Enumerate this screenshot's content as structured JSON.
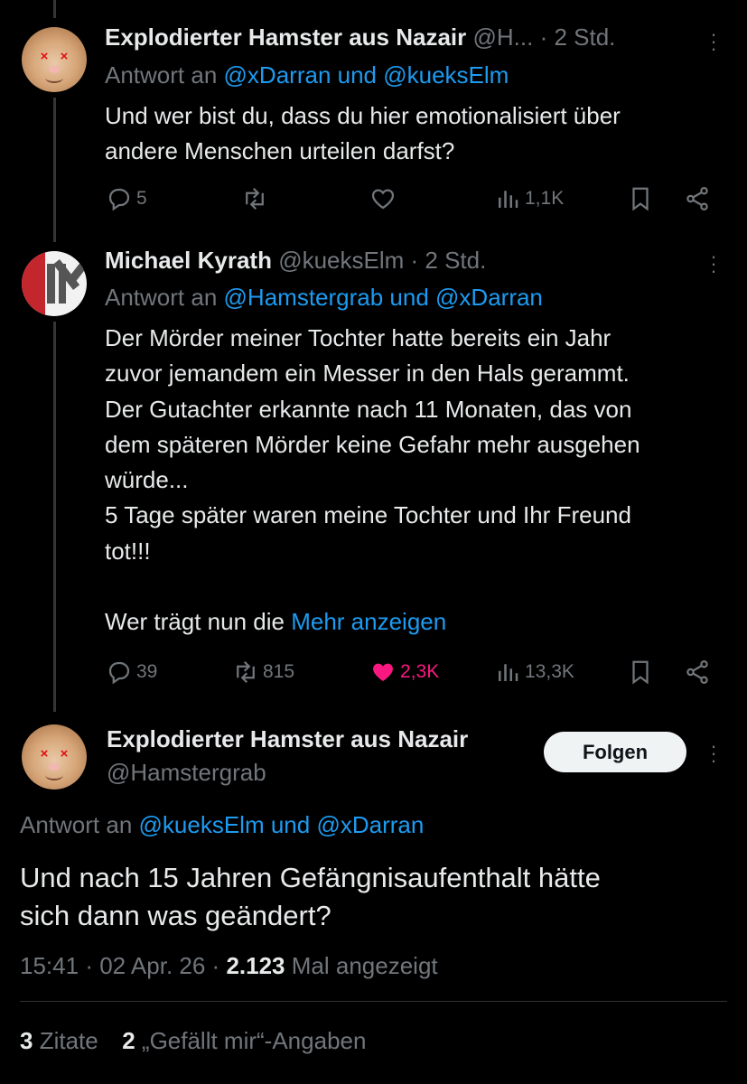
{
  "tweet1": {
    "display_name": "Explodierter Hamster aus Nazair",
    "handle": "@H...",
    "time": "· 2 Std.",
    "reply_prefix": "Antwort an",
    "reply_to": "@xDarran und @kueksElm",
    "text_lines": [
      "Und wer bist du, dass du hier emotionalisiert über",
      "andere Menschen urteilen darfst?"
    ],
    "replies": "5",
    "retweets": "",
    "likes": "",
    "views": "1,1K"
  },
  "tweet2": {
    "display_name": "Michael Kyrath",
    "handle": "@kueksElm",
    "time": "· 2 Std.",
    "reply_prefix": "Antwort an",
    "reply_to": "@Hamstergrab und @xDarran",
    "text_lines": [
      "Der Mörder meiner Tochter hatte bereits ein Jahr",
      "zuvor jemandem ein Messer in den Hals gerammt.",
      "Der Gutachter erkannte nach 11 Monaten, das von",
      "dem späteren Mörder keine Gefahr mehr ausgehen",
      "würde...",
      "5 Tage später waren meine Tochter und Ihr Freund",
      "tot!!!",
      "",
      "Wer trägt nun die"
    ],
    "show_more": "Mehr anzeigen",
    "replies": "39",
    "retweets": "815",
    "likes": "2,3K",
    "views": "13,3K"
  },
  "main_tweet": {
    "display_name": "Explodierter Hamster aus Nazair",
    "handle": "@Hamstergrab",
    "follow_label": "Folgen",
    "reply_prefix": "Antwort an",
    "reply_to": "@kueksElm und @xDarran",
    "text_lines": [
      "Und nach 15 Jahren Gefängnisaufenthalt hätte",
      "sich dann was geändert?"
    ],
    "time": "15:41",
    "date": "02 Apr. 26",
    "views_count": "2.123",
    "views_label": "Mal angezeigt",
    "quotes_count": "3",
    "quotes_label": "Zitate",
    "likes_count": "2",
    "likes_label": "„Gefällt mir“-Angaben"
  },
  "colors": {
    "background": "#000000",
    "text": "#e7e9ea",
    "muted": "#71767b",
    "link": "#1d9bf0",
    "like": "#f91880"
  }
}
